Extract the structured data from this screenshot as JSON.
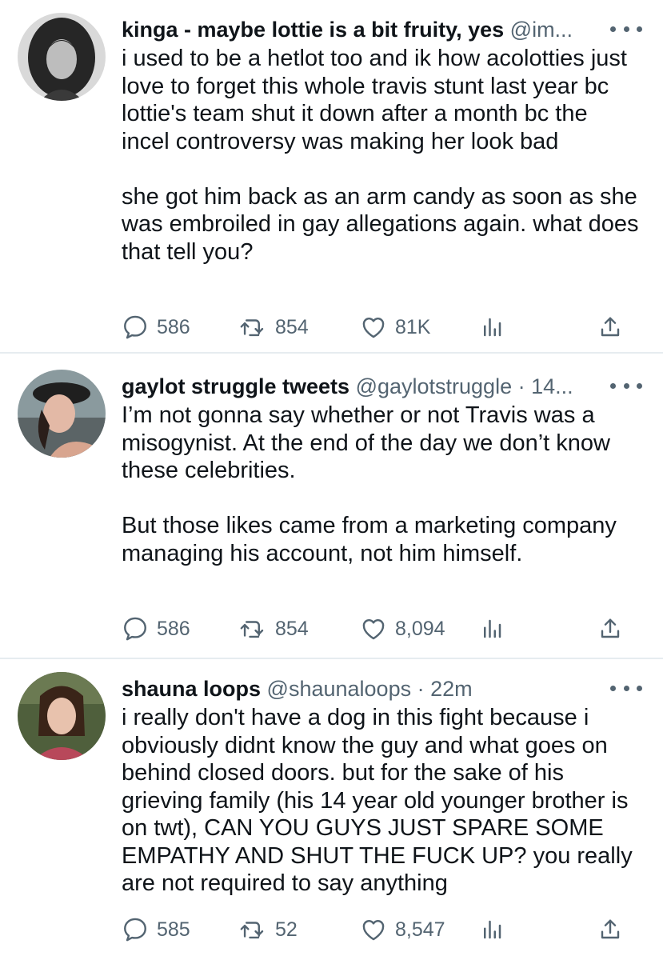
{
  "tweets": [
    {
      "display_name": "kinga - maybe lottie is a bit fruity, yes",
      "handle": "@im...",
      "time": "",
      "text": [
        "i used to be a hetlot too and ik how acolotties just love to forget this whole travis stunt last year bc lottie's team shut it down after a month bc the incel controversy was making her look bad",
        "she got him back as an arm candy as soon as she was embroiled in gay allegations again. what does that tell you?"
      ],
      "replies": "586",
      "retweets": "854",
      "likes": "81K",
      "icons": [
        "reply-icon",
        "retweet-icon",
        "like-icon",
        "views-icon",
        "share-icon",
        "more-icon"
      ]
    },
    {
      "display_name": "gaylot struggle tweets",
      "handle": "@gaylotstruggle",
      "time": "14...",
      "text": [
        "I’m not gonna say whether or not Travis was a misogynist. At the end of the day we don’t know these celebrities.",
        "But those likes came from a marketing company managing his account, not him himself."
      ],
      "replies": "586",
      "retweets": "854",
      "likes": "8,094"
    },
    {
      "display_name": "shauna loops",
      "handle": "@shaunaloops",
      "time": "22m",
      "text": [
        "i really don't have a dog in this fight because i obviously didnt know the guy and what goes on behind closed doors. but for the sake of his grieving family (his 14 year old younger brother is on twt), CAN YOU GUYS JUST SPARE SOME EMPATHY AND SHUT THE FUCK UP? you really are not required to say anything"
      ],
      "replies": "585",
      "retweets": "52",
      "likes": "8,547"
    }
  ],
  "colors": {
    "text": "#0f1419",
    "secondary": "#536471",
    "divider": "#e6ecf0",
    "accent": "#1d9bf0"
  }
}
